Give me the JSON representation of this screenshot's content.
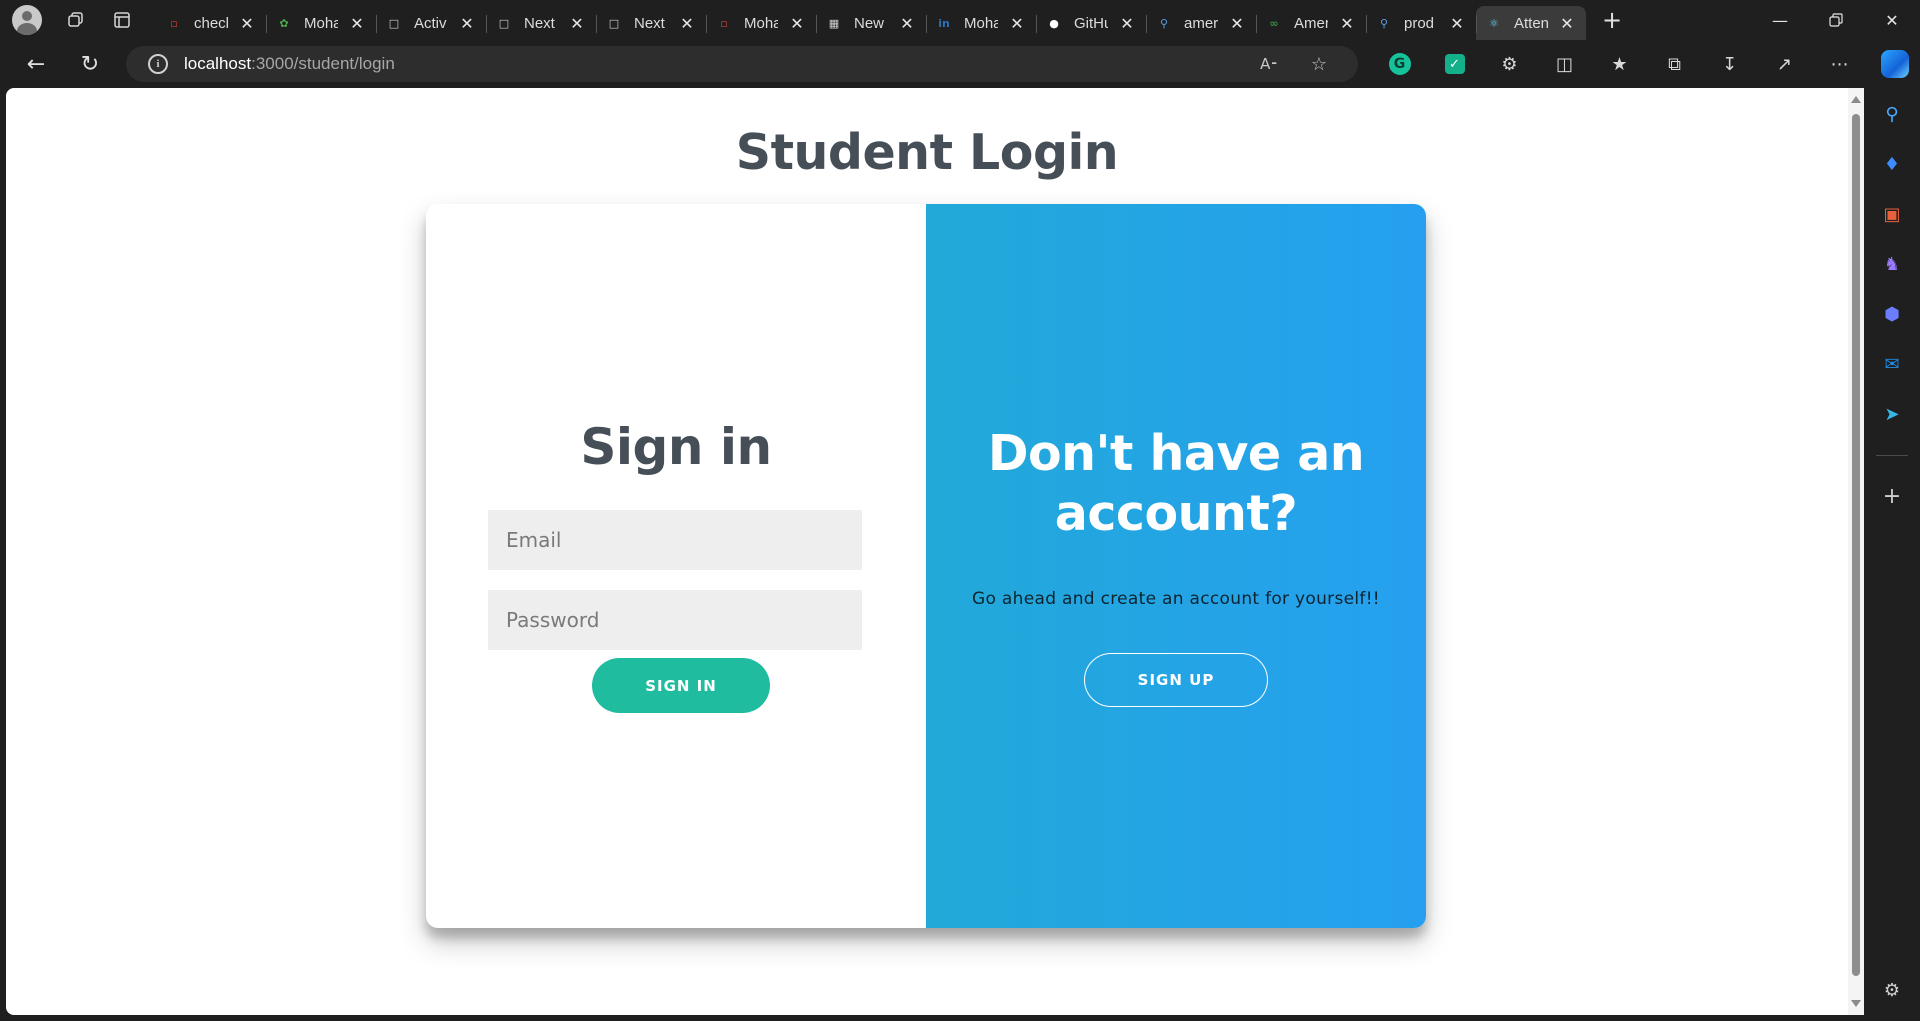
{
  "browser": {
    "tabs": [
      {
        "title": "check",
        "favicon": "pdf-icon",
        "color": "#c74634"
      },
      {
        "title": "Moha",
        "favicon": "mongodb-leaf-icon",
        "color": "#4fa94d"
      },
      {
        "title": "Activ",
        "favicon": "document-icon",
        "color": "#cfcfcf"
      },
      {
        "title": "Next",
        "favicon": "document-icon",
        "color": "#cfcfcf"
      },
      {
        "title": "Next",
        "favicon": "document-icon",
        "color": "#cfcfcf"
      },
      {
        "title": "Moha",
        "favicon": "pdf-icon",
        "color": "#c74634"
      },
      {
        "title": "New",
        "favicon": "new-tab-page-icon",
        "color": "#cfcfcf"
      },
      {
        "title": "Moha",
        "favicon": "linkedin-icon",
        "color": "#2d6fb5"
      },
      {
        "title": "GitHu",
        "favicon": "github-icon",
        "color": "#ffffff"
      },
      {
        "title": "amer",
        "favicon": "search-icon",
        "color": "#5aa0e6"
      },
      {
        "title": "Amer",
        "favicon": "infinity-icon",
        "color": "#3a8f4a"
      },
      {
        "title": "prod",
        "favicon": "search-icon",
        "color": "#5aa0e6"
      },
      {
        "title": "Atten",
        "favicon": "react-icon",
        "color": "#61dafb",
        "active": true
      }
    ],
    "url": {
      "host": "localhost",
      "path": ":3000/student/login"
    }
  },
  "page": {
    "title": "Student Login",
    "signin": {
      "heading": "Sign in",
      "email_placeholder": "Email",
      "password_placeholder": "Password",
      "button_label": "SIGN IN"
    },
    "signup": {
      "heading_line1": "Don't have an",
      "heading_line2": "account?",
      "text": "Go ahead and create an account for yourself!!",
      "button_label": "SIGN UP"
    }
  },
  "colors": {
    "accent_green": "#20bc9f",
    "panel_gradient_start": "#22a9d8",
    "panel_gradient_end": "#25a0f0",
    "heading_text": "#464e58"
  }
}
